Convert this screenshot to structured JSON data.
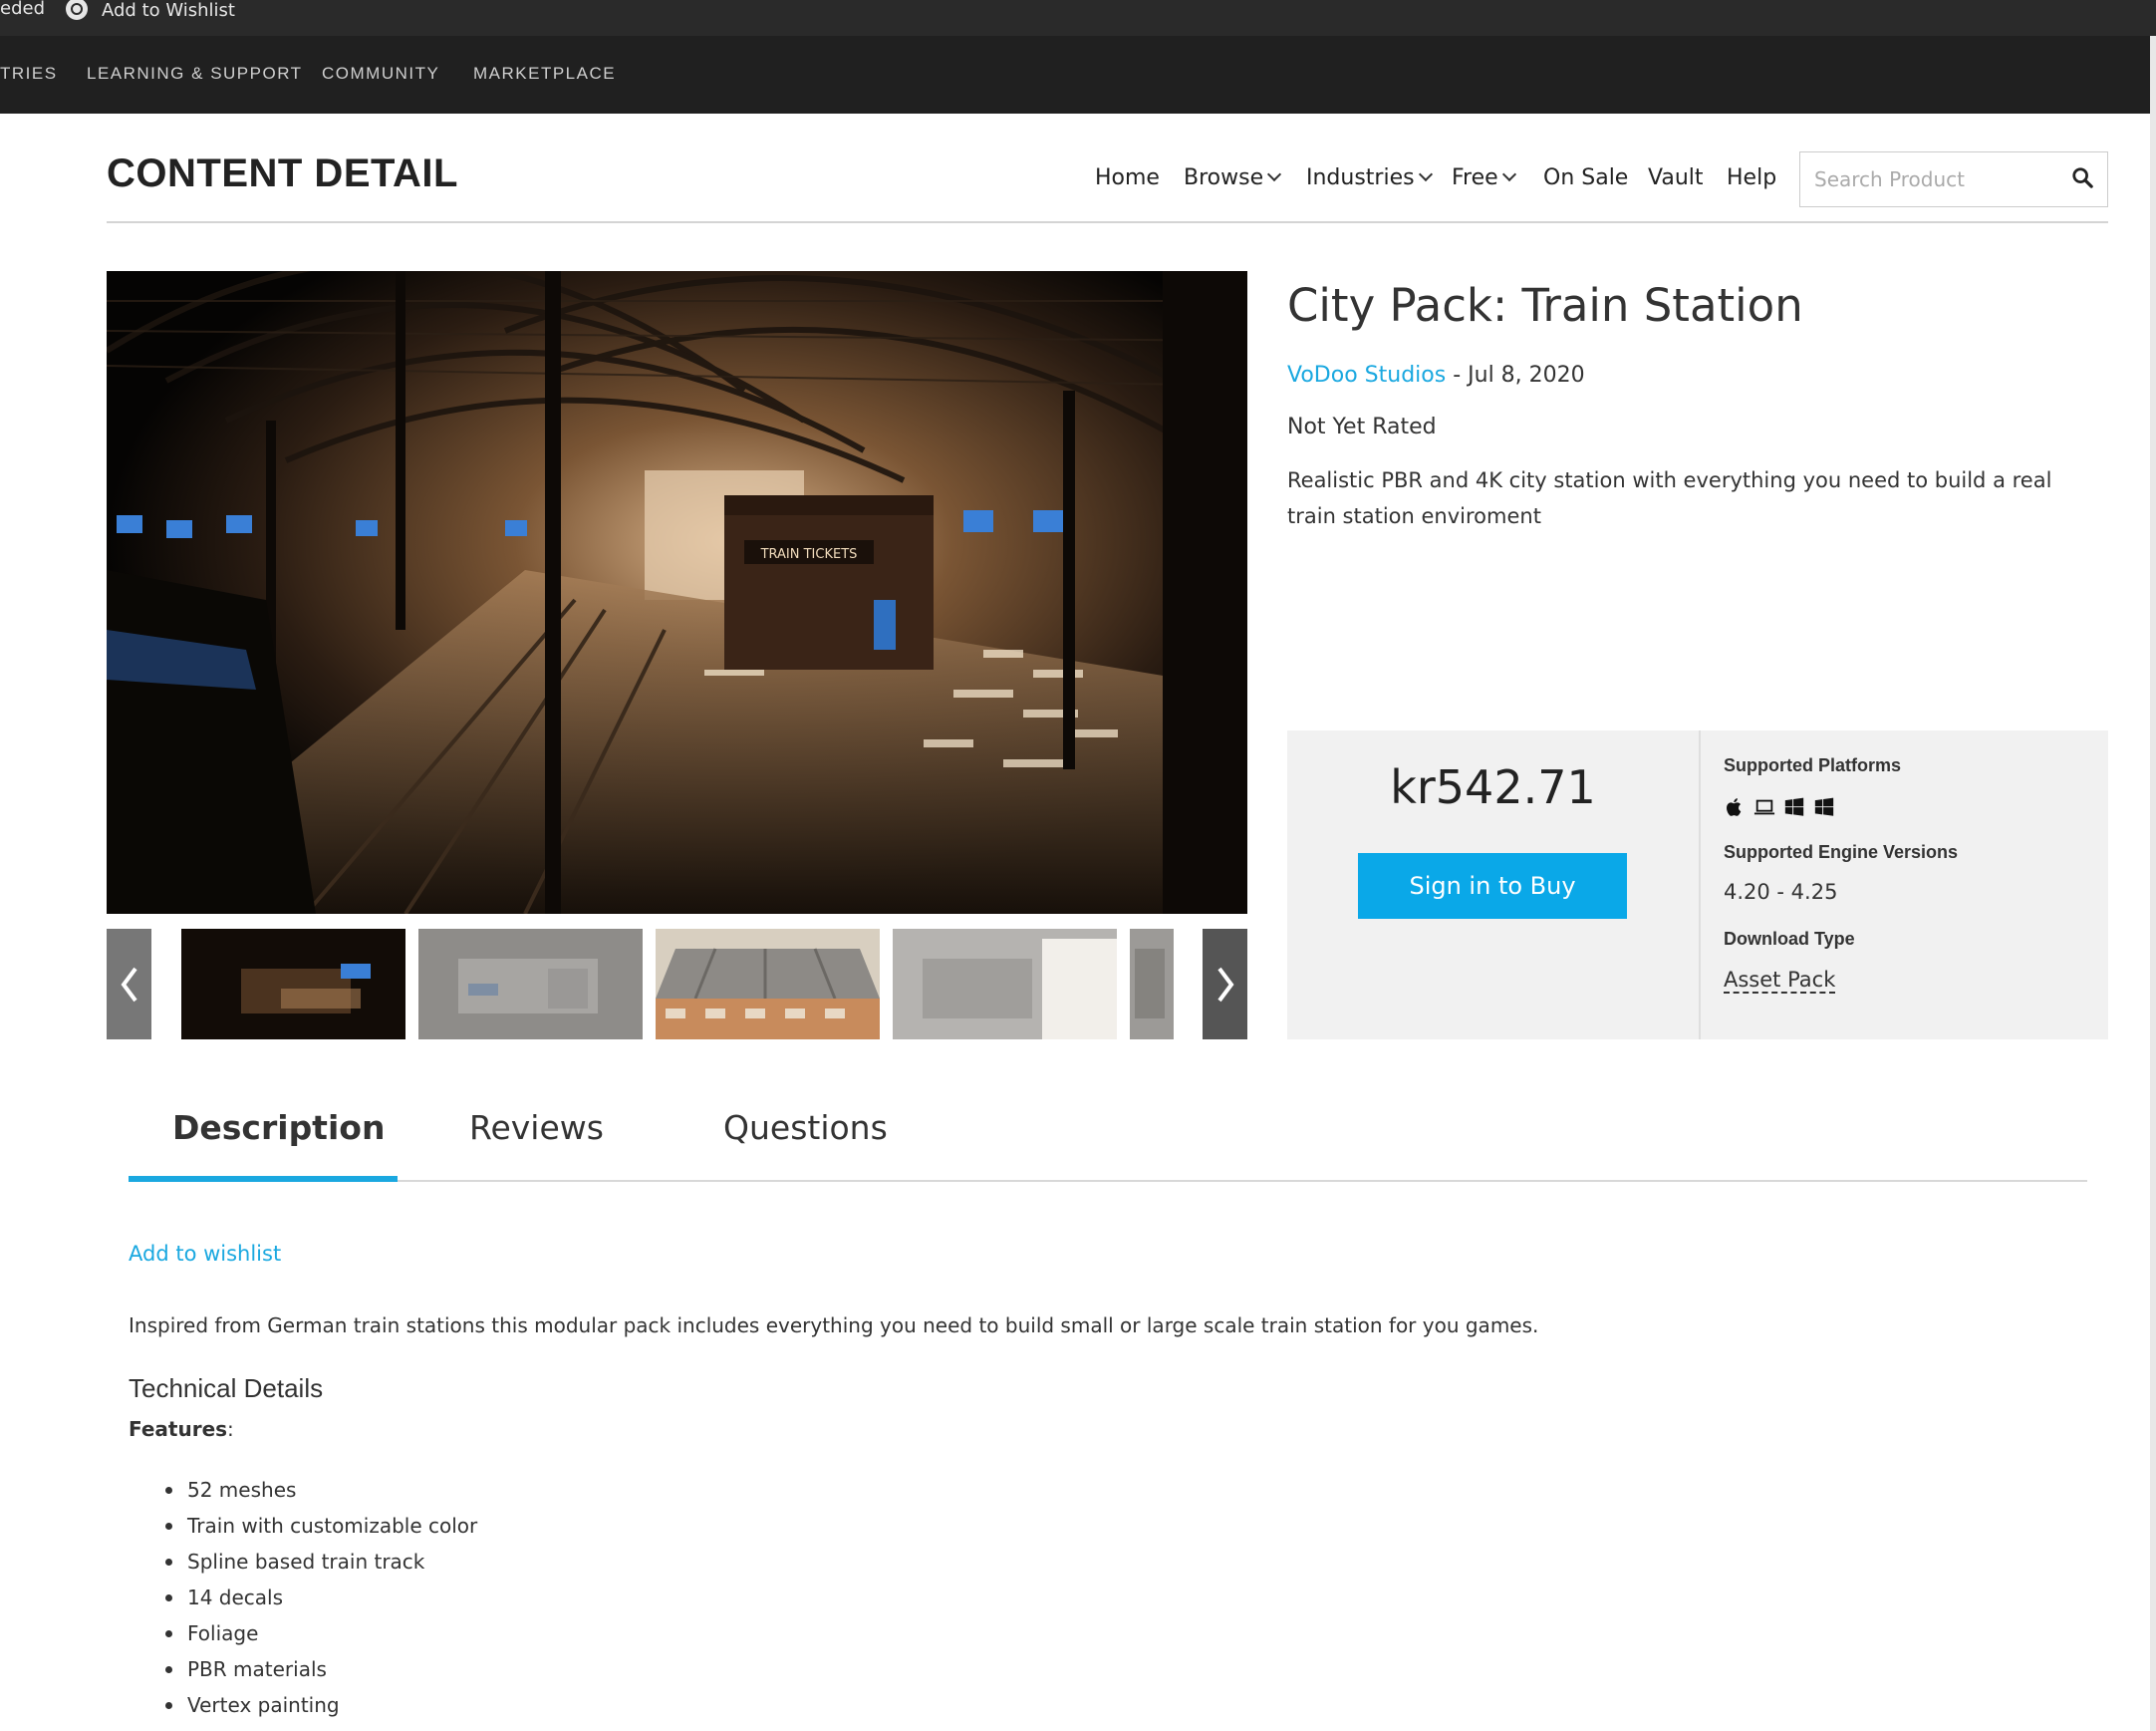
{
  "browser_strip": {
    "left_text": "eded",
    "wishlist_label": "Add to Wishlist"
  },
  "site_nav": {
    "items": [
      "TRIES",
      "LEARNING & SUPPORT",
      "COMMUNITY",
      "MARKETPLACE"
    ]
  },
  "store_header": {
    "title": "CONTENT DETAIL",
    "nav": [
      "Home",
      "Browse",
      "Industries",
      "Free",
      "On Sale",
      "Vault",
      "Help"
    ],
    "search_placeholder": "Search Product"
  },
  "product": {
    "title": "City Pack: Train Station",
    "seller": "VoDoo Studios",
    "date_sep": " - ",
    "date": "Jul 8, 2020",
    "rating": "Not Yet Rated",
    "summary": "Realistic PBR and 4K city station with everything you need to build a real train station enviroment",
    "hero_sign": "TRAIN TICKETS"
  },
  "purchase": {
    "price": "kr542.71",
    "buy_label": "Sign in to Buy",
    "platforms_label": "Supported Platforms",
    "platforms": [
      "apple-icon",
      "laptop-icon",
      "windows-icon",
      "windows-icon"
    ],
    "engine_label": "Supported Engine Versions",
    "engine_versions": "4.20 - 4.25",
    "download_label": "Download Type",
    "download_type": "Asset Pack"
  },
  "tabs": [
    "Description",
    "Reviews",
    "Questions"
  ],
  "description": {
    "add_wishlist": "Add to wishlist",
    "text": "Inspired from German train stations this modular pack includes everything you need to build small or large scale train station for you games.",
    "technical_title": "Technical Details",
    "features_label": "Features",
    "features_colon": ":",
    "features": [
      "52 meshes",
      "Train with customizable color",
      "Spline based train track",
      "14 decals",
      "Foliage",
      "PBR materials",
      "Vertex painting"
    ]
  },
  "colors": {
    "accent": "#1aa8e0",
    "buy_button": "#0aa8e8",
    "nav_bg": "#202020"
  }
}
